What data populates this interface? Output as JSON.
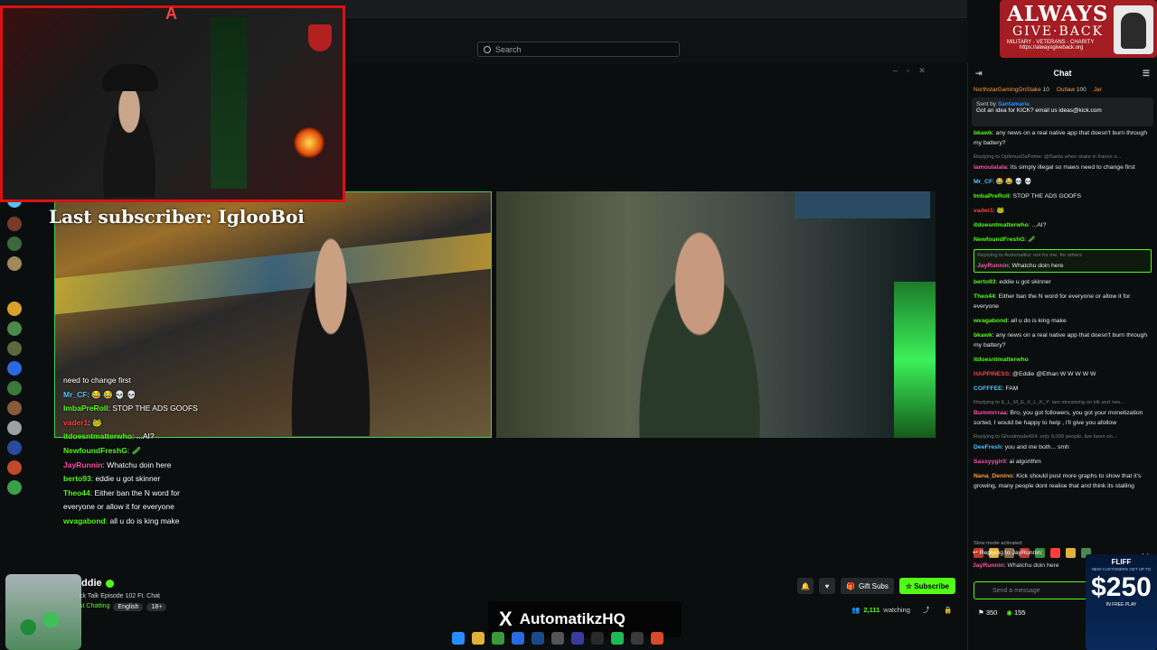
{
  "search": {
    "placeholder": "Search"
  },
  "overlay": {
    "last_subscriber": "Last subscriber: IglooBoi",
    "badge": {
      "title": "ALWAYS",
      "subtitle": "GIVE·BACK",
      "tagline": "MILITARY - VETERANS - CHARITY",
      "url": "https://alwaysgiveback.org"
    },
    "x_handle": "AutomatikzHQ",
    "video_chat": [
      {
        "user": "",
        "text": "need to change first",
        "color": "#ffffff"
      },
      {
        "user": "Mr_CF",
        "text": ": 😂 😂 💀 💀",
        "color": "#4fc3ff"
      },
      {
        "user": "ImbaPreRoll",
        "text": ": STOP THE ADS GOOFS",
        "color": "#53fc18"
      },
      {
        "user": "vader1",
        "text": ": 🐸",
        "color": "#ff3d3d"
      },
      {
        "user": "itdoesntmatterwho",
        "text": ": ...AI?",
        "color": "#53fc18"
      },
      {
        "user": "NewfoundFreshG",
        "text": ": 🥒",
        "color": "#53fc18"
      },
      {
        "user": "JayRunnin",
        "text": ": Whatchu doin here",
        "color": "#ff4fa8"
      },
      {
        "user": "berto93",
        "text": ": eddie u got skinner",
        "color": "#53fc18"
      },
      {
        "user": "Theo44",
        "text": ": Either ban the N word for",
        "color": "#53fc18"
      },
      {
        "user": "",
        "text": "everyone or allow it for everyone",
        "color": "#ffffff"
      },
      {
        "user": "wvagabond",
        "text": ": all u do is king make",
        "color": "#53fc18"
      }
    ]
  },
  "stream": {
    "streamer": "ddie",
    "title": "ck Talk Episode 102 Ft. Chat",
    "category": "st Chatting",
    "language": "English",
    "age": "18+",
    "gift_subs_label": "Gift Subs",
    "subscribe_label": "Subscribe",
    "viewers": "2,111",
    "watching_label": "watching"
  },
  "chat": {
    "title": "Chat",
    "top_gifters": [
      {
        "name": "NorthstarGamingOnStake",
        "amount": "10"
      },
      {
        "name": "Outlaw",
        "amount": "100"
      },
      {
        "name": "Jar",
        "amount": ""
      }
    ],
    "pinned": {
      "sent_by_label": "Sent by",
      "sender": "Santamaria",
      "text": "Got an idea for KICK? email us ideas@kick.com"
    },
    "messages": [
      {
        "reply": "",
        "user": "bkawk",
        "color": "#53fc18",
        "text": ": any news on a real native app that doesn't burn through my battery?",
        "highlight": false
      },
      {
        "reply": "Replying to OptimusDaPrime: @Santa when stake in france o...",
        "user": "lamoulalala",
        "color": "#ff4fa8",
        "text": ": Its simply illegal so maws need to change first",
        "highlight": false
      },
      {
        "reply": "",
        "user": "Mr_CF",
        "color": "#4fc3ff",
        "text": ": 😂 😂 💀 💀",
        "highlight": false
      },
      {
        "reply": "",
        "user": "ImbaPreRoll",
        "color": "#53fc18",
        "text": ": STOP THE ADS GOOFS",
        "highlight": false
      },
      {
        "reply": "",
        "user": "vader1",
        "color": "#ff3d3d",
        "text": ": 🐸",
        "highlight": false
      },
      {
        "reply": "",
        "user": "itdoesntmatterwho",
        "color": "#53fc18",
        "text": ": ...AI?",
        "highlight": false
      },
      {
        "reply": "",
        "user": "NewfoundFreshG",
        "color": "#53fc18",
        "text": ": 🥒",
        "highlight": false
      },
      {
        "reply": "Replying to Automatikz: not for me, for others",
        "user": "JayRunnin",
        "color": "#ff4fa8",
        "text": ": Whatchu doin here",
        "highlight": true
      },
      {
        "reply": "",
        "user": "berto93",
        "color": "#53fc18",
        "text": ": eddie u got skinner",
        "highlight": false
      },
      {
        "reply": "",
        "user": "Theo44",
        "color": "#53fc18",
        "text": ": Either ban the N word for everyone or allow it for everyone",
        "highlight": false
      },
      {
        "reply": "",
        "user": "wvagabond",
        "color": "#53fc18",
        "text": ": all u do is king make",
        "highlight": false
      },
      {
        "reply": "",
        "user": "bkawk",
        "color": "#53fc18",
        "text": ": any news on a real native app that doesn't burn through my battery?",
        "highlight": false
      },
      {
        "reply": "",
        "user": "itdoesntmatterwho",
        "color": "#53fc18",
        "text": "",
        "highlight": false
      },
      {
        "reply": "",
        "user": "HAPPINESS",
        "color": "#ff3d3d",
        "text": ": @Eddie @Ethan W W W W W",
        "highlight": false
      },
      {
        "reply": "",
        "user": "COFFFEE",
        "color": "#4fc3ff",
        "text": ": FAM",
        "highlight": false
      },
      {
        "reply": "Replying to E_L_M_E_X_L_K_Y: iam streaming on kik and nee...",
        "user": "Bummrrraa",
        "color": "#ff4fa8",
        "text": ": Bro, you got followers, you got your monetization sorted, I would be happy to help , i'll give you afollow",
        "highlight": false
      },
      {
        "reply": "Replying to Ghostmode424: only 9,000 people, live been on...",
        "user": "DeeFresh",
        "color": "#4fc3ff",
        "text": ": you and me both... smh",
        "highlight": false
      },
      {
        "reply": "",
        "user": "Sassyygirll",
        "color": "#ff4fa8",
        "text": ": ai algorithm",
        "highlight": false
      },
      {
        "reply": "",
        "user": "Nana_Denino",
        "color": "#ff9b3d",
        "text": ": Kick should post more graphs to show that it's growing, many people dont realise that and think its stalling",
        "highlight": false
      }
    ],
    "slow_mode": "Slow mode activated",
    "replying_to": "Replying to JayRunnin:",
    "reply_quote_user": "JayRunnin",
    "reply_quote_text": ": Whatchu doin here",
    "send_placeholder": "Send a message",
    "footer_count_1": "350",
    "footer_count_2": "155"
  },
  "ad": {
    "brand": "FLIFF",
    "fine_print": "NEW CUSTOMERS GET UP TO",
    "amount": "$250",
    "free": "IN FREE PLAY"
  },
  "colors": {
    "accent": "#53fc18",
    "overlay_red": "#d11111"
  }
}
